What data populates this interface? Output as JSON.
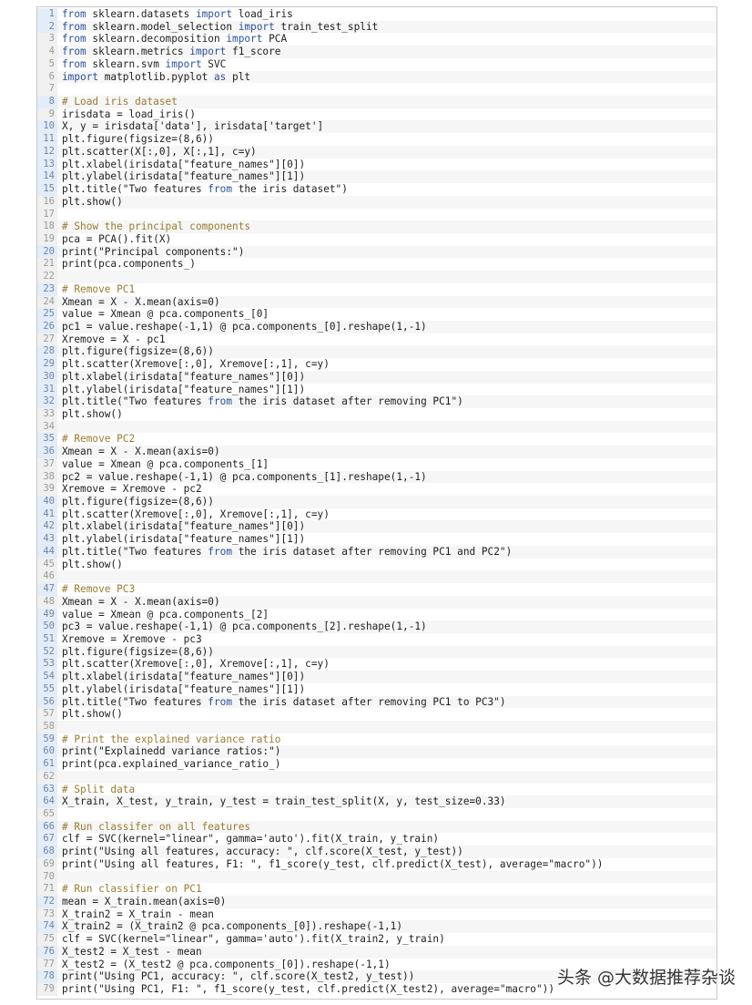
{
  "editor": {
    "lines": [
      "from sklearn.datasets import load_iris",
      "from sklearn.model_selection import train_test_split",
      "from sklearn.decomposition import PCA",
      "from sklearn.metrics import f1_score",
      "from sklearn.svm import SVC",
      "import matplotlib.pyplot as plt",
      "",
      "# Load iris dataset",
      "irisdata = load_iris()",
      "X, y = irisdata['data'], irisdata['target']",
      "plt.figure(figsize=(8,6))",
      "plt.scatter(X[:,0], X[:,1], c=y)",
      "plt.xlabel(irisdata[\"feature_names\"][0])",
      "plt.ylabel(irisdata[\"feature_names\"][1])",
      "plt.title(\"Two features from the iris dataset\")",
      "plt.show()",
      "",
      "# Show the principal components",
      "pca = PCA().fit(X)",
      "print(\"Principal components:\")",
      "print(pca.components_)",
      "",
      "# Remove PC1",
      "Xmean = X - X.mean(axis=0)",
      "value = Xmean @ pca.components_[0]",
      "pc1 = value.reshape(-1,1) @ pca.components_[0].reshape(1,-1)",
      "Xremove = X - pc1",
      "plt.figure(figsize=(8,6))",
      "plt.scatter(Xremove[:,0], Xremove[:,1], c=y)",
      "plt.xlabel(irisdata[\"feature_names\"][0])",
      "plt.ylabel(irisdata[\"feature_names\"][1])",
      "plt.title(\"Two features from the iris dataset after removing PC1\")",
      "plt.show()",
      "",
      "# Remove PC2",
      "Xmean = X - X.mean(axis=0)",
      "value = Xmean @ pca.components_[1]",
      "pc2 = value.reshape(-1,1) @ pca.components_[1].reshape(1,-1)",
      "Xremove = Xremove - pc2",
      "plt.figure(figsize=(8,6))",
      "plt.scatter(Xremove[:,0], Xremove[:,1], c=y)",
      "plt.xlabel(irisdata[\"feature_names\"][0])",
      "plt.ylabel(irisdata[\"feature_names\"][1])",
      "plt.title(\"Two features from the iris dataset after removing PC1 and PC2\")",
      "plt.show()",
      "",
      "# Remove PC3",
      "Xmean = X - X.mean(axis=0)",
      "value = Xmean @ pca.components_[2]",
      "pc3 = value.reshape(-1,1) @ pca.components_[2].reshape(1,-1)",
      "Xremove = Xremove - pc3",
      "plt.figure(figsize=(8,6))",
      "plt.scatter(Xremove[:,0], Xremove[:,1], c=y)",
      "plt.xlabel(irisdata[\"feature_names\"][0])",
      "plt.ylabel(irisdata[\"feature_names\"][1])",
      "plt.title(\"Two features from the iris dataset after removing PC1 to PC3\")",
      "plt.show()",
      "",
      "# Print the explained variance ratio",
      "print(\"Explainedd variance ratios:\")",
      "print(pca.explained_variance_ratio_)",
      "",
      "# Split data",
      "X_train, X_test, y_train, y_test = train_test_split(X, y, test_size=0.33)",
      "",
      "# Run classifer on all features",
      "clf = SVC(kernel=\"linear\", gamma='auto').fit(X_train, y_train)",
      "print(\"Using all features, accuracy: \", clf.score(X_test, y_test))",
      "print(\"Using all features, F1: \", f1_score(y_test, clf.predict(X_test), average=\"macro\"))",
      "",
      "# Run classifier on PC1",
      "mean = X_train.mean(axis=0)",
      "X_train2 = X_train - mean",
      "X_train2 = (X_train2 @ pca.components_[0]).reshape(-1,1)",
      "clf = SVC(kernel=\"linear\", gamma='auto').fit(X_train2, y_train)",
      "X_test2 = X_test - mean",
      "X_test2 = (X_test2 @ pca.components_[0]).reshape(-1,1)",
      "print(\"Using PC1, accuracy: \", clf.score(X_test2, y_test))",
      "print(\"Using PC1, F1: \", f1_score(y_test, clf.predict(X_test2), average=\"macro\"))"
    ],
    "first_line_number": 1
  },
  "watermark": "头条 @大数据推荐杂谈",
  "colors": {
    "keyword": "#2a4f9e",
    "comment": "#9a7a30",
    "text": "#1e1e1e",
    "gutter_bg": "#f0f0f0",
    "gutter_text": "#9a9a9a"
  }
}
